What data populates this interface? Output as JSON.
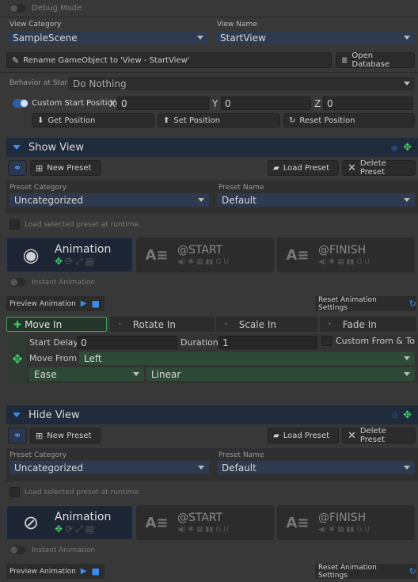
{
  "debug": {
    "label": "Debug Mode"
  },
  "view_category": {
    "label": "View Category",
    "value": "SampleScene"
  },
  "view_name": {
    "label": "View Name",
    "value": "StartView"
  },
  "rename_button": "Rename GameObject to 'View - StartView'",
  "open_database_button": "Open Database",
  "behavior": {
    "label": "Behavior at Start",
    "value": "Do Nothing"
  },
  "custom_start": {
    "label": "Custom Start Position",
    "x_label": "X",
    "x": "0",
    "y_label": "Y",
    "y": "0",
    "z_label": "Z",
    "z": "0"
  },
  "position_buttons": {
    "get": "Get Position",
    "set": "Set Position",
    "reset": "Reset Position"
  },
  "show_view": {
    "title": "Show View",
    "new_preset": "New Preset",
    "load_preset": "Load Preset",
    "delete_preset": "Delete Preset",
    "preset_category_label": "Preset Category",
    "preset_category": "Uncategorized",
    "preset_name_label": "Preset Name",
    "preset_name": "Default",
    "load_runtime": "Load selected preset at runtime.",
    "animation": "Animation",
    "start": "@START",
    "finish": "@FINISH",
    "instant": "Instant Animation",
    "preview": "Preview Animation",
    "reset_settings": "Reset Animation Settings",
    "tabs": [
      "Move In",
      "Rotate In",
      "Scale In",
      "Fade In"
    ],
    "start_delay_label": "Start Delay",
    "start_delay": "0",
    "duration_label": "Duration",
    "duration": "1",
    "custom_from_to": "Custom From & To",
    "move_from_label": "Move From",
    "move_from": "Left",
    "ease": "Ease",
    "ease_type": "Linear"
  },
  "hide_view": {
    "title": "Hide View",
    "new_preset": "New Preset",
    "load_preset": "Load Preset",
    "delete_preset": "Delete Preset",
    "preset_category_label": "Preset Category",
    "preset_category": "Uncategorized",
    "preset_name_label": "Preset Name",
    "preset_name": "Default",
    "load_runtime": "Load selected preset at runtime.",
    "animation": "Animation",
    "start": "@START",
    "finish": "@FINISH",
    "instant": "Instant Animation",
    "preview": "Preview Animation",
    "reset_settings": "Reset Animation Settings"
  },
  "colors": {
    "accent_green": "#3fcf6a",
    "accent_blue": "#3a8cf0",
    "header_bg": "#1f2a3a",
    "bg": "#383838"
  }
}
